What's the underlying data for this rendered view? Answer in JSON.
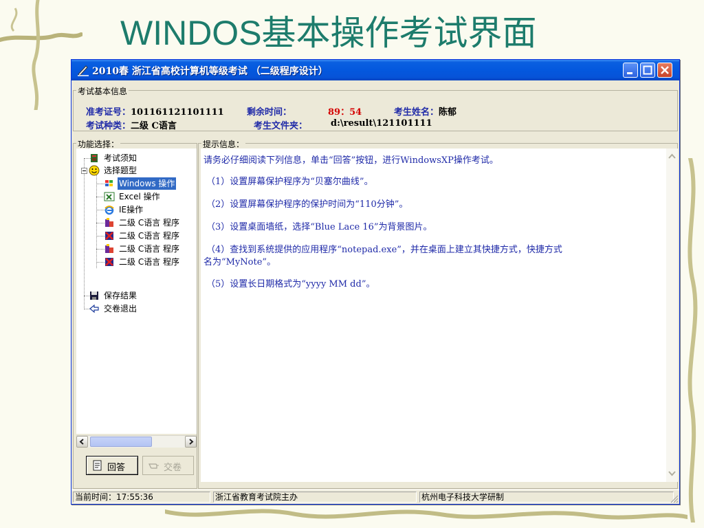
{
  "slide": {
    "title": "WINDOS基本操作考试界面"
  },
  "window": {
    "title": "2010春 浙江省高校计算机等级考试 （二级程序设计）",
    "icons": {
      "app": "pen-icon",
      "minimize": "minimize-icon",
      "maximize": "maximize-icon",
      "close": "close-icon"
    }
  },
  "exam_info": {
    "group_label": "考试基本信息",
    "ticket_label": "准考证号：",
    "ticket_value": "101161121101111",
    "time_label": "剩余时间：",
    "time_value": "89：54",
    "name_label": "考生姓名：",
    "name_value": "陈郁",
    "type_label": "考试种类：",
    "type_value": "二级 C语言",
    "folder_label": "考生文件夹：",
    "folder_value": "d:\\result\\121101111"
  },
  "function_panel": {
    "group_label": "功能选择：",
    "tree": [
      {
        "label": "考试须知",
        "icon": "info-book-icon",
        "level": 1
      },
      {
        "label": "选择题型",
        "icon": "smiley-icon",
        "level": 1,
        "expanded": true
      },
      {
        "label": "Windows 操作",
        "icon": "windows-flag-icon",
        "level": 2,
        "selected": true
      },
      {
        "label": "Excel 操作",
        "icon": "excel-icon",
        "level": 2
      },
      {
        "label": "IE操作",
        "icon": "ie-icon",
        "level": 2
      },
      {
        "label": "二级 C语言 程序",
        "icon": "program-icon",
        "level": 2
      },
      {
        "label": "二级 C语言 程序",
        "icon": "program-red-icon",
        "level": 2
      },
      {
        "label": "二级 C语言 程序",
        "icon": "program-icon",
        "level": 2
      },
      {
        "label": "二级 C语言 程序",
        "icon": "program-red-icon",
        "level": 2
      },
      {
        "label": "保存结果",
        "icon": "floppy-icon",
        "level": 1
      },
      {
        "label": "交卷退出",
        "icon": "exit-arrow-icon",
        "level": 1
      }
    ],
    "answer_button": "回答",
    "submit_button": "交卷"
  },
  "hint_panel": {
    "group_label": "提示信息：",
    "lines": [
      "请务必仔细阅读下列信息，单击“回答”按钮，进行WindowsXP操作考试。",
      "（1）设置屏幕保护程序为“贝塞尔曲线”。",
      "（2）设置屏幕保护程序的保护时间为“110分钟”。",
      "（3）设置桌面墙纸，选择“Blue Lace 16”为背景图片。",
      "（4）查找到系统提供的应用程序“notepad.exe”，并在桌面上建立其快捷方式，快捷方式",
      "名为“MyNote”。",
      "（5）设置长日期格式为“yyyy MM dd”。"
    ]
  },
  "status_bar": {
    "time": "当前时间：17:55:36",
    "organizer": "浙江省教育考试院主办",
    "developer": "杭州电子科技大学研制"
  }
}
